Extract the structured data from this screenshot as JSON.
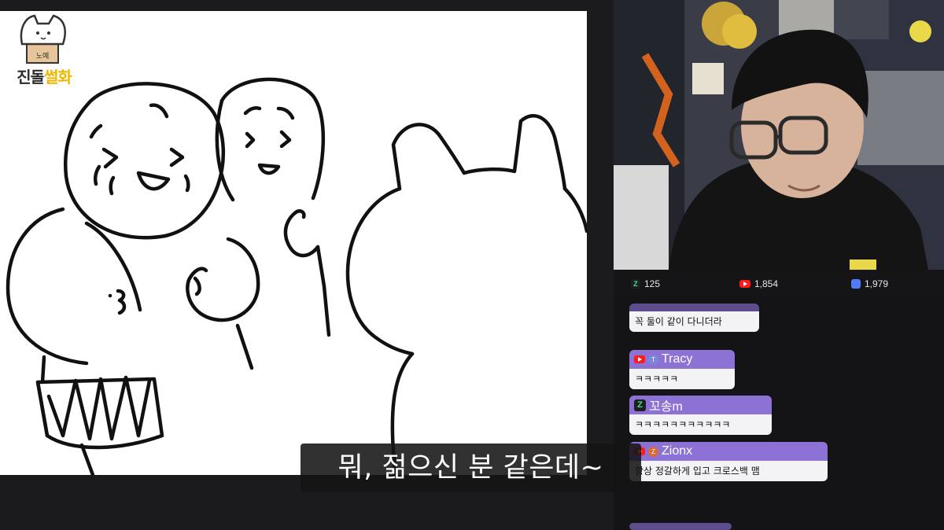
{
  "logo": {
    "text_a": "진돌",
    "text_b": "썰화",
    "box_label": "노예"
  },
  "viewers": [
    {
      "platform": "chzzk",
      "icon": "chzzk-icon",
      "count": "125",
      "color": "#2ad0a0"
    },
    {
      "platform": "youtube",
      "icon": "youtube-icon",
      "count": "1,854",
      "color": "#ff1a1a"
    },
    {
      "platform": "soop",
      "icon": "soop-icon",
      "count": "1,979",
      "color": "#4f7cff"
    }
  ],
  "chat": {
    "messages": [
      {
        "username": "",
        "text": "꼭 둘이 같이 다니더라",
        "platform": "youtube"
      },
      {
        "username": "Tracy",
        "badge": "T",
        "badge_color": "#7a86d6",
        "text": "ㅋㅋㅋㅋㅋ",
        "platform": "youtube"
      },
      {
        "username": "꼬송m",
        "text": "ㅋㅋㅋㅋㅋㅋㅋㅋㅋㅋㅋ",
        "platform": "chzzk"
      },
      {
        "username": "Zionx",
        "badge": "Z",
        "badge_color": "#d96a3a",
        "text": "항상 정갈하게 입고 크로스백 맴",
        "platform": "youtube"
      }
    ]
  },
  "subtitle": {
    "text": "뭐, 젊으신 분 같은데~"
  },
  "colors": {
    "chat_header": "#8d72d6",
    "chat_body": "#f3f3f5",
    "background": "#1b1b1d"
  }
}
